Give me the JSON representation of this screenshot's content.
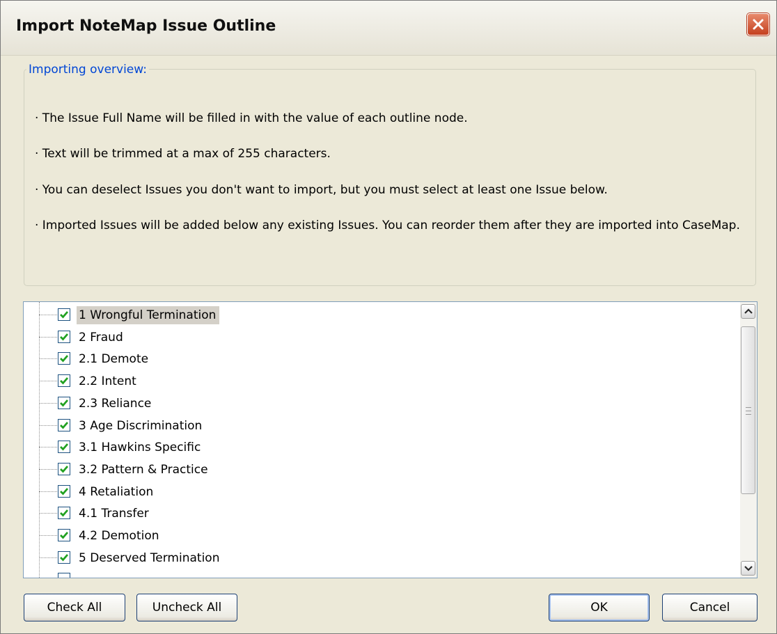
{
  "window": {
    "title": "Import NoteMap Issue Outline",
    "close_icon": "close-icon",
    "accent_color": "#d65a3a"
  },
  "overview": {
    "legend": "Importing overview:",
    "bullets": [
      "· The Issue Full Name will be filled in with the value of each outline node.",
      "· Text will be trimmed at a max of 255 characters.",
      "· You can deselect Issues you don't want to import, but you must select at least one Issue below.",
      "· Imported Issues will be added below any existing Issues. You can reorder them after they are imported into CaseMap."
    ]
  },
  "issues": [
    {
      "label": "1 Wrongful Termination",
      "checked": true,
      "selected": true
    },
    {
      "label": "2 Fraud",
      "checked": true
    },
    {
      "label": "2.1 Demote",
      "checked": true
    },
    {
      "label": "2.2 Intent",
      "checked": true
    },
    {
      "label": "2.3 Reliance",
      "checked": true
    },
    {
      "label": "3 Age Discrimination",
      "checked": true
    },
    {
      "label": "3.1 Hawkins Specific",
      "checked": true
    },
    {
      "label": "3.2 Pattern & Practice",
      "checked": true
    },
    {
      "label": "4 Retaliation",
      "checked": true
    },
    {
      "label": "4.1 Transfer",
      "checked": true
    },
    {
      "label": "4.2 Demotion",
      "checked": true
    },
    {
      "label": "5 Deserved Termination",
      "checked": true
    }
  ],
  "buttons": {
    "check_all": "Check All",
    "uncheck_all": "Uncheck All",
    "ok": "OK",
    "cancel": "Cancel"
  },
  "colors": {
    "legend_text": "#0046d5",
    "check_mark": "#21a121",
    "selection_bg": "#d4d0c8"
  }
}
